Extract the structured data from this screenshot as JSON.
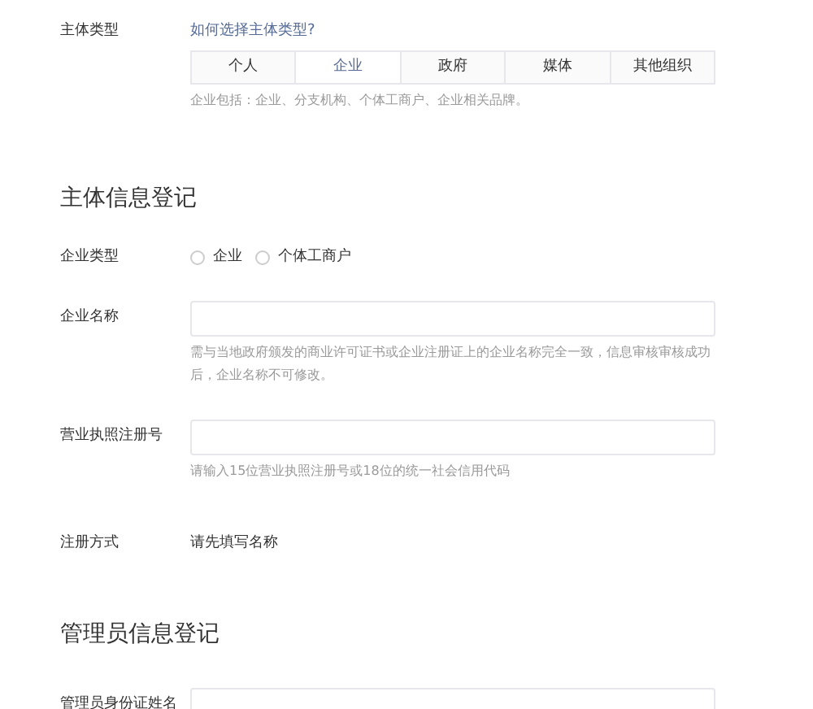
{
  "subject_type": {
    "label": "主体类型",
    "help_link": "如何选择主体类型?",
    "tabs": [
      {
        "label": "个人",
        "selected": false
      },
      {
        "label": "企业",
        "selected": true
      },
      {
        "label": "政府",
        "selected": false
      },
      {
        "label": "媒体",
        "selected": false
      },
      {
        "label": "其他组织",
        "selected": false
      }
    ],
    "hint": "企业包括：企业、分支机构、个体工商户、企业相关品牌。"
  },
  "sections": [
    {
      "title": "主体信息登记",
      "rows": [
        {
          "kind": "radio",
          "label": "企业类型",
          "options": [
            {
              "label": "企业",
              "selected": false
            },
            {
              "label": "个体工商户",
              "selected": false
            }
          ]
        },
        {
          "kind": "input",
          "label": "企业名称",
          "hint": "需与当地政府颁发的商业许可证书或企业注册证上的企业名称完全一致，信息审核审核成功后，企业名称不可修改。"
        },
        {
          "kind": "input",
          "label": "营业执照注册号",
          "hint": "请输入15位营业执照注册号或18位的统一社会信用代码"
        },
        {
          "kind": "text",
          "label": "注册方式",
          "value": "请先填写名称"
        }
      ]
    },
    {
      "title": "管理员信息登记",
      "rows": [
        {
          "kind": "input",
          "label": "管理员身份证姓名"
        }
      ]
    }
  ]
}
